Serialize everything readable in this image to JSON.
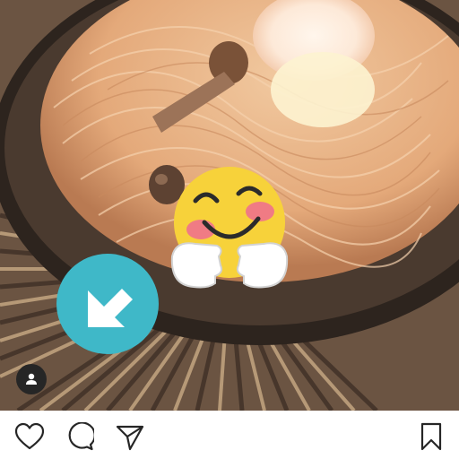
{
  "post": {
    "image_subject": "food-photo",
    "stickers": [
      "arrow-down-left-icon",
      "hugging-face-emoji"
    ]
  },
  "overlay": {
    "tag_button_icon": "user-tag-icon"
  },
  "actions": {
    "like_icon": "heart-icon",
    "comment_icon": "comment-icon",
    "share_icon": "paper-plane-icon",
    "save_icon": "bookmark-icon"
  },
  "colors": {
    "sticker_teal": "#3fb8c8",
    "emoji_yellow": "#f7d23a",
    "emoji_cheek": "#f07b84",
    "icon_stroke": "#262626",
    "bar_background": "#ffffff"
  }
}
